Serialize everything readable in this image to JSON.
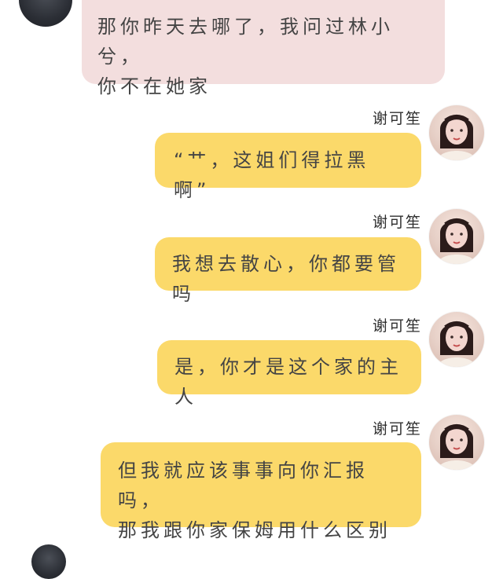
{
  "messages": [
    {
      "side": "left",
      "avatar": "dark-portrait-avatar",
      "text_lines": [
        "那你昨天去哪了，我问过林小兮，",
        "你不在她家"
      ]
    },
    {
      "side": "right",
      "sender": "谢可笙",
      "avatar": "woman-portrait-avatar",
      "text_lines": [
        "“艹，这姐们得拉黑啊”"
      ]
    },
    {
      "side": "right",
      "sender": "谢可笙",
      "avatar": "woman-portrait-avatar",
      "text_lines": [
        "我想去散心，你都要管吗"
      ]
    },
    {
      "side": "right",
      "sender": "谢可笙",
      "avatar": "woman-portrait-avatar",
      "text_lines": [
        "是，你才是这个家的主人"
      ]
    },
    {
      "side": "right",
      "sender": "谢可笙",
      "avatar": "woman-portrait-avatar",
      "text_lines": [
        "但我就应该事事向你汇报吗，",
        "那我跟你家保姆用什么区别"
      ]
    }
  ],
  "colors": {
    "left_bubble": "#f3dede",
    "right_bubble": "#fbd96a",
    "background": "#ffffff"
  }
}
